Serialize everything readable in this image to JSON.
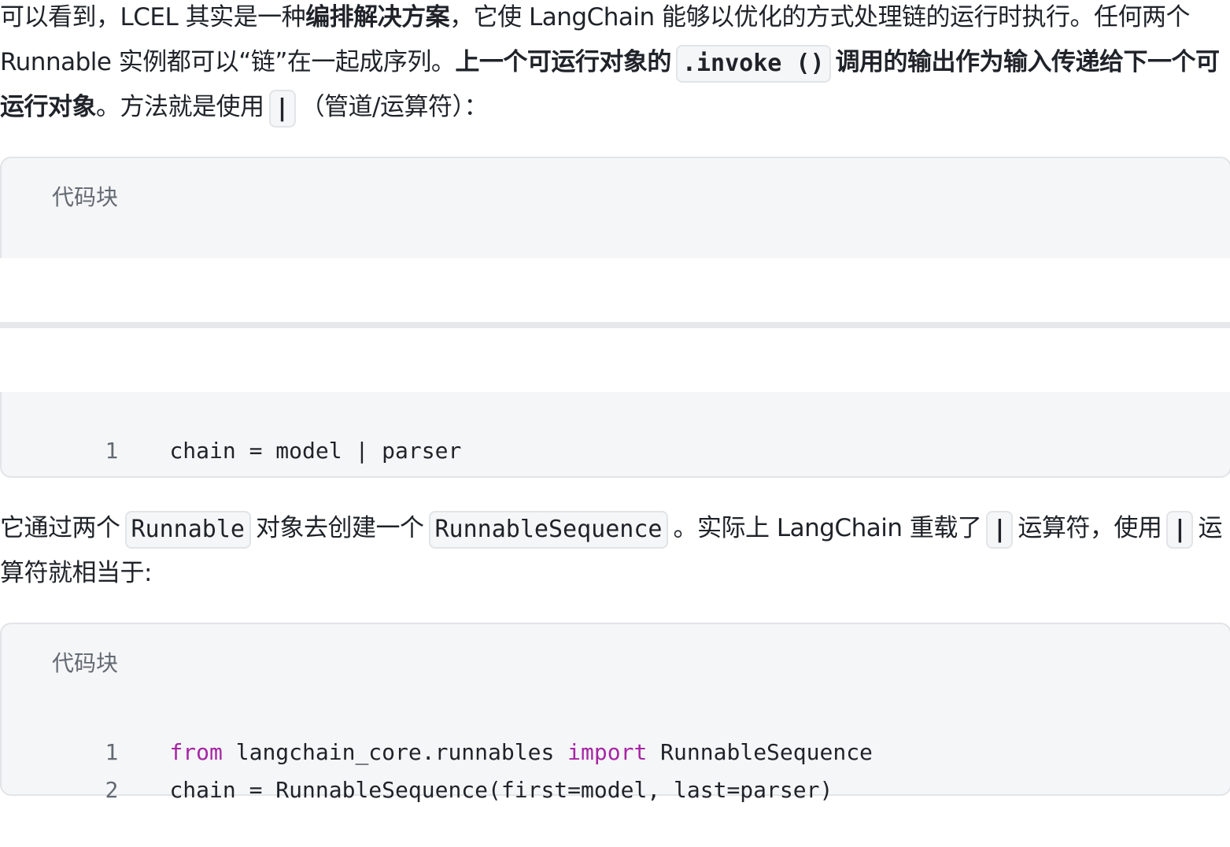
{
  "para1": {
    "t1": "可以看到，LCEL 其实是一种",
    "b1": "编排解决方案",
    "t2": "，它使 LangChain 能够以优化的方式处理链的运行时执行。任何两个 Runnable 实例都可以“链”在一起成序列。",
    "b2": "上一个可运行对象的",
    "code1": ".invoke ()",
    "b3": "调用的输出作为输入传递给下一个可运行对象",
    "t3": "。方法就是使用",
    "code2": "|",
    "t4": "（管道/运算符）："
  },
  "codeblock1": {
    "label": "代码块",
    "lines": [
      {
        "num": "1",
        "text": "chain = model | parser"
      }
    ]
  },
  "para2": {
    "t1": "它通过两个",
    "code1": "Runnable",
    "t2": "对象去创建一个",
    "code2": "RunnableSequence",
    "t3": "。实际上 LangChain 重载了",
    "code3": "|",
    "t4": "运算符，使用",
    "code4": "|",
    "t5": "运算符就相当于:"
  },
  "codeblock2": {
    "label": "代码块",
    "line1": {
      "num": "1",
      "kw1": "from",
      "mid": " langchain_core.runnables ",
      "kw2": "import",
      "rest": " RunnableSequence"
    },
    "line2": {
      "num": "2",
      "text": "chain = RunnableSequence(first=model, last=parser)"
    }
  }
}
